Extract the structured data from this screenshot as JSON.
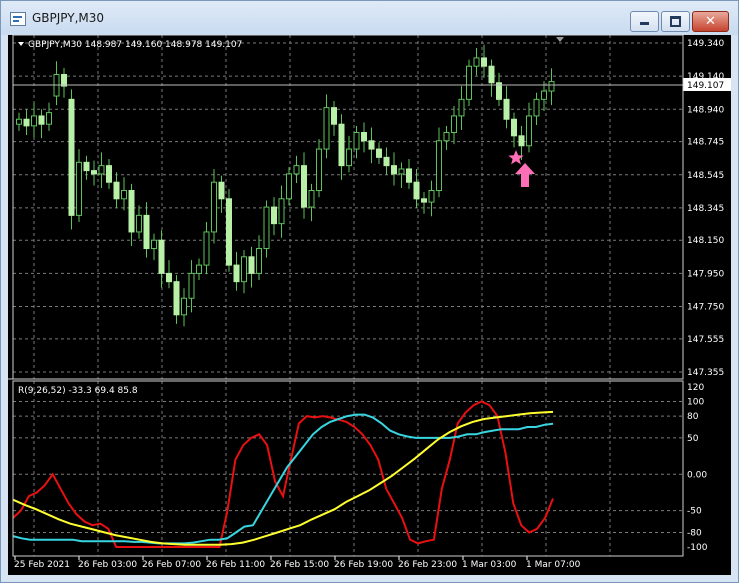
{
  "window": {
    "title": "GBPJPY,M30",
    "buttons": {
      "minimize": "–",
      "maximize": "□",
      "close": "✕"
    },
    "colors": {
      "frame": "#d6e4f4",
      "close": "#c5442f"
    }
  },
  "price_chart": {
    "info_line": "GBPJPY,M30  148.987 149.160 148.978 149.107",
    "current_price_label": "149.107",
    "y_axis_labels": [
      "149.340",
      "149.140",
      "148.940",
      "148.745",
      "148.545",
      "148.345",
      "148.150",
      "147.950",
      "147.750",
      "147.555",
      "147.355"
    ],
    "colors": {
      "candles": "#b8f0a8",
      "wicks": "#5ec25a",
      "background": "#000000",
      "grid": "#7a7a7a",
      "signal": "#ff6fb8"
    },
    "signal_markers": [
      "star-icon",
      "up-arrow-icon"
    ]
  },
  "indicator": {
    "info_line": "R(9,26,52) -33.3 69.4 85.8",
    "y_axis_labels": [
      "120",
      "100",
      "80",
      "50",
      "0.00",
      "-50",
      "-80",
      "-100"
    ],
    "colors": {
      "fast": "#e81010",
      "medium": "#38d6e0",
      "slow": "#ffff30"
    }
  },
  "x_axis_labels": [
    "25 Feb 2021",
    "26 Feb 03:00",
    "26 Feb 07:00",
    "26 Feb 11:00",
    "26 Feb 15:00",
    "26 Feb 19:00",
    "26 Feb 23:00",
    "1 Mar 03:00",
    "1 Mar 07:00"
  ],
  "chart_data": [
    {
      "type": "candlestick",
      "title": "GBPJPY,M30",
      "ylim": [
        147.355,
        149.34
      ],
      "x": [
        "25 Feb 2021",
        "26 Feb 03:00",
        "26 Feb 07:00",
        "26 Feb 11:00",
        "26 Feb 15:00",
        "26 Feb 19:00",
        "26 Feb 23:00",
        "1 Mar 03:00",
        "1 Mar 07:00"
      ],
      "series": [
        {
          "close": [
            148.88,
            148.84,
            148.9,
            148.85,
            148.92,
            149.15,
            149.08,
            148.3,
            148.62,
            148.57,
            148.55,
            148.6,
            148.5,
            148.4,
            148.45,
            148.2,
            148.3,
            148.1,
            148.15,
            147.95,
            147.9,
            147.7,
            147.8,
            147.95,
            148.0,
            148.2,
            148.5,
            148.4,
            148.0,
            147.9,
            148.05,
            147.95,
            148.1,
            148.35,
            148.25,
            148.4,
            148.55,
            148.6,
            148.35,
            148.45,
            148.7,
            148.95,
            148.85,
            148.6,
            148.7,
            148.8,
            148.75,
            148.7,
            148.65,
            148.6,
            148.55,
            148.58,
            148.5,
            148.4,
            148.38,
            148.45,
            148.75,
            148.8,
            148.9,
            149.0,
            149.2,
            149.25,
            149.2,
            149.1,
            149.0,
            148.88,
            148.78,
            148.72,
            148.9,
            149.0,
            149.05,
            149.107
          ]
        },
        {
          "open": [
            148.85,
            148.88,
            148.84,
            148.9,
            148.85,
            149.02,
            149.15,
            149.0,
            148.3,
            148.62,
            148.57,
            148.55,
            148.6,
            148.5,
            148.4,
            148.45,
            148.2,
            148.3,
            148.1,
            148.15,
            147.95,
            147.9,
            147.7,
            147.8,
            147.95,
            148.0,
            148.2,
            148.5,
            148.4,
            148.0,
            147.9,
            148.05,
            147.95,
            148.1,
            148.35,
            148.25,
            148.4,
            148.55,
            148.6,
            148.35,
            148.45,
            148.7,
            148.95,
            148.85,
            148.6,
            148.7,
            148.8,
            148.75,
            148.7,
            148.65,
            148.6,
            148.55,
            148.58,
            148.5,
            148.4,
            148.38,
            148.45,
            148.75,
            148.8,
            148.9,
            149.0,
            149.2,
            149.25,
            149.2,
            149.1,
            149.0,
            148.88,
            148.78,
            148.72,
            148.9,
            149.0,
            149.05
          ]
        }
      ]
    },
    {
      "type": "line",
      "title": "R(9,26,52) -33.3 69.4 85.8",
      "ylim": [
        -100,
        120
      ],
      "series": [
        {
          "name": "",
          "values": [
            -60,
            -50,
            -30,
            -25,
            -15,
            0,
            -20,
            -40,
            -55,
            -65,
            -70,
            -68,
            -75,
            -100,
            -100,
            -100,
            -100,
            -100,
            -100,
            -100,
            -100,
            -100,
            -100,
            -100,
            -100,
            -100,
            -100,
            -50,
            20,
            40,
            50,
            55,
            40,
            -10,
            -30,
            20,
            70,
            80,
            78,
            80,
            78,
            75,
            72,
            65,
            55,
            40,
            20,
            -20,
            -40,
            -60,
            -90,
            -95,
            -92,
            -90,
            -20,
            20,
            70,
            85,
            95,
            100,
            95,
            80,
            30,
            -40,
            -70,
            -80,
            -75,
            -60,
            -33.3
          ]
        },
        {
          "name": "",
          "values": [
            -85,
            -88,
            -90,
            -90,
            -90,
            -90,
            -90,
            -90,
            -92,
            -92,
            -92,
            -92,
            -92,
            -92,
            -93,
            -93,
            -94,
            -95,
            -95,
            -95,
            -95,
            -94,
            -92,
            -90,
            -90,
            -88,
            -80,
            -72,
            -70,
            -50,
            -30,
            -10,
            10,
            25,
            40,
            55,
            65,
            72,
            76,
            80,
            82,
            82,
            78,
            70,
            60,
            55,
            52,
            50,
            50,
            50,
            50,
            50,
            52,
            55,
            55,
            58,
            60,
            62,
            62,
            62,
            65,
            65,
            68,
            69.4
          ]
        },
        {
          "name": "",
          "values": [
            -35,
            -42,
            -48,
            -55,
            -62,
            -68,
            -72,
            -76,
            -80,
            -84,
            -87,
            -90,
            -93,
            -95,
            -96,
            -97,
            -97,
            -97,
            -97,
            -96,
            -94,
            -90,
            -85,
            -80,
            -75,
            -70,
            -62,
            -55,
            -48,
            -38,
            -30,
            -22,
            -12,
            -2,
            10,
            22,
            35,
            48,
            58,
            66,
            72,
            76,
            78,
            80,
            82,
            84,
            85,
            85.8
          ]
        }
      ]
    }
  ]
}
